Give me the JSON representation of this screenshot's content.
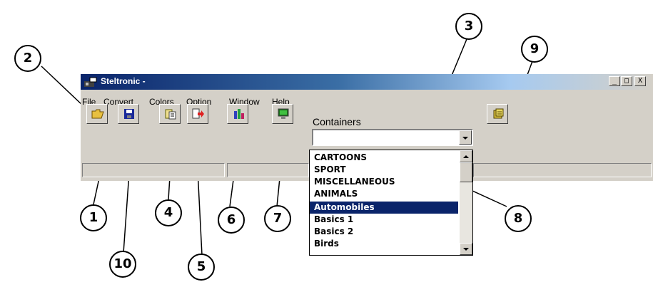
{
  "window": {
    "title": "Steltronic -",
    "controls": {
      "minimize": "_",
      "maximize": "□",
      "close": "X"
    }
  },
  "menu": [
    "File",
    "Convert",
    "Colors",
    "Option",
    "Window",
    "Help"
  ],
  "toolbar": {
    "icons": [
      "open-folder-icon",
      "save-disk-icon",
      "convert-icon",
      "export-arrow-icon",
      "colors-bars-icon",
      "monitor-icon",
      "database-icon"
    ]
  },
  "containers": {
    "label": "Containers",
    "value": "",
    "items": [
      "CARTOONS",
      "SPORT",
      "MISCELLANEOUS",
      "ANIMALS",
      "Automobiles",
      "Basics 1",
      "Basics 2",
      "Birds"
    ],
    "selected": "Automobiles"
  },
  "callouts": [
    "1",
    "2",
    "3",
    "4",
    "5",
    "6",
    "7",
    "8",
    "9",
    "10"
  ],
  "colors": {
    "title_start": "#0a246a",
    "selection": "#0a246a",
    "face": "#d4d0c8"
  }
}
